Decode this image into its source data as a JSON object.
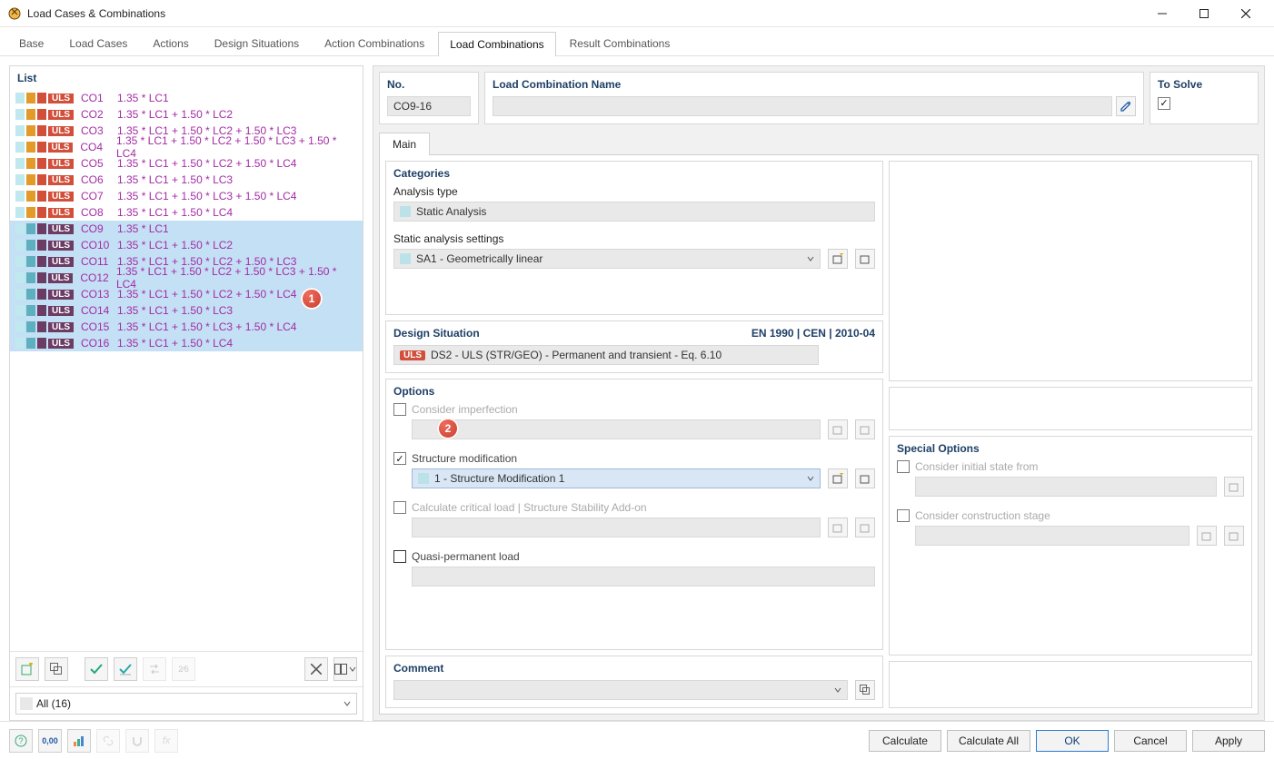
{
  "window": {
    "title": "Load Cases & Combinations"
  },
  "tabs": [
    "Base",
    "Load Cases",
    "Actions",
    "Design Situations",
    "Action Combinations",
    "Load Combinations",
    "Result Combinations"
  ],
  "active_tab_index": 5,
  "list": {
    "heading": "List",
    "items": [
      {
        "sel": false,
        "sw": [
          "lt1",
          "o",
          "r"
        ],
        "ulsClass": "red",
        "uls": "ULS",
        "id": "CO1",
        "desc": "1.35 * LC1"
      },
      {
        "sel": false,
        "sw": [
          "lt1",
          "o",
          "r"
        ],
        "ulsClass": "red",
        "uls": "ULS",
        "id": "CO2",
        "desc": "1.35 * LC1 + 1.50 * LC2"
      },
      {
        "sel": false,
        "sw": [
          "lt1",
          "o",
          "r"
        ],
        "ulsClass": "red",
        "uls": "ULS",
        "id": "CO3",
        "desc": "1.35 * LC1 + 1.50 * LC2 + 1.50 * LC3"
      },
      {
        "sel": false,
        "sw": [
          "lt1",
          "o",
          "r"
        ],
        "ulsClass": "red",
        "uls": "ULS",
        "id": "CO4",
        "desc": "1.35 * LC1 + 1.50 * LC2 + 1.50 * LC3 + 1.50 * LC4"
      },
      {
        "sel": false,
        "sw": [
          "lt1",
          "o",
          "r"
        ],
        "ulsClass": "red",
        "uls": "ULS",
        "id": "CO5",
        "desc": "1.35 * LC1 + 1.50 * LC2 + 1.50 * LC4"
      },
      {
        "sel": false,
        "sw": [
          "lt1",
          "o",
          "r"
        ],
        "ulsClass": "red",
        "uls": "ULS",
        "id": "CO6",
        "desc": "1.35 * LC1 + 1.50 * LC3"
      },
      {
        "sel": false,
        "sw": [
          "lt1",
          "o",
          "r"
        ],
        "ulsClass": "red",
        "uls": "ULS",
        "id": "CO7",
        "desc": "1.35 * LC1 + 1.50 * LC3 + 1.50 * LC4"
      },
      {
        "sel": false,
        "sw": [
          "lt1",
          "o",
          "r"
        ],
        "ulsClass": "red",
        "uls": "ULS",
        "id": "CO8",
        "desc": "1.35 * LC1 + 1.50 * LC4"
      },
      {
        "sel": true,
        "sw": [
          "lt1",
          "db",
          "pu"
        ],
        "ulsClass": "pu",
        "uls": "ULS",
        "id": "CO9",
        "desc": "1.35 * LC1"
      },
      {
        "sel": true,
        "sw": [
          "lt1",
          "db",
          "pu"
        ],
        "ulsClass": "pu",
        "uls": "ULS",
        "id": "CO10",
        "desc": "1.35 * LC1 + 1.50 * LC2"
      },
      {
        "sel": true,
        "sw": [
          "lt1",
          "db",
          "pu"
        ],
        "ulsClass": "pu",
        "uls": "ULS",
        "id": "CO11",
        "desc": "1.35 * LC1 + 1.50 * LC2 + 1.50 * LC3"
      },
      {
        "sel": true,
        "sw": [
          "lt1",
          "db",
          "pu"
        ],
        "ulsClass": "pu",
        "uls": "ULS",
        "id": "CO12",
        "desc": "1.35 * LC1 + 1.50 * LC2 + 1.50 * LC3 + 1.50 * LC4"
      },
      {
        "sel": true,
        "sw": [
          "lt1",
          "db",
          "pu"
        ],
        "ulsClass": "pu",
        "uls": "ULS",
        "id": "CO13",
        "desc": "1.35 * LC1 + 1.50 * LC2 + 1.50 * LC4"
      },
      {
        "sel": true,
        "sw": [
          "lt1",
          "db",
          "pu"
        ],
        "ulsClass": "pu",
        "uls": "ULS",
        "id": "CO14",
        "desc": "1.35 * LC1 + 1.50 * LC3"
      },
      {
        "sel": true,
        "sw": [
          "lt1",
          "db",
          "pu"
        ],
        "ulsClass": "pu",
        "uls": "ULS",
        "id": "CO15",
        "desc": "1.35 * LC1 + 1.50 * LC3 + 1.50 * LC4"
      },
      {
        "sel": true,
        "sw": [
          "lt1",
          "db",
          "pu"
        ],
        "ulsClass": "pu",
        "uls": "ULS",
        "id": "CO16",
        "desc": "1.35 * LC1 + 1.50 * LC4"
      }
    ],
    "filter_label": "All (16)",
    "annot1": "1"
  },
  "header": {
    "no_label": "No.",
    "no_value": "CO9-16",
    "name_label": "Load Combination Name",
    "name_value": "",
    "to_solve_label": "To Solve",
    "to_solve_checked": true
  },
  "inner_tabs": [
    "Main"
  ],
  "categories": {
    "heading": "Categories",
    "analysis_type_label": "Analysis type",
    "analysis_type_value": "Static Analysis",
    "settings_label": "Static analysis settings",
    "settings_value": "SA1 - Geometrically linear"
  },
  "design_situation": {
    "heading": "Design Situation",
    "standard": "EN 1990 | CEN | 2010-04",
    "badge": "ULS",
    "value": "DS2 - ULS (STR/GEO) - Permanent and transient - Eq. 6.10"
  },
  "options": {
    "heading": "Options",
    "annot2": "2",
    "consider_imperfection": {
      "label": "Consider imperfection",
      "checked": false,
      "value": ""
    },
    "structure_modification": {
      "label": "Structure modification",
      "checked": true,
      "value": "1 - Structure Modification 1"
    },
    "critical_load": {
      "label": "Calculate critical load | Structure Stability Add-on",
      "checked": false,
      "value": ""
    },
    "quasi_permanent": {
      "label": "Quasi-permanent load",
      "checked": false,
      "value": ""
    }
  },
  "special_options": {
    "heading": "Special Options",
    "initial_state": {
      "label": "Consider initial state from",
      "checked": false
    },
    "construction_stage": {
      "label": "Consider construction stage",
      "checked": false
    }
  },
  "comment": {
    "heading": "Comment",
    "value": ""
  },
  "footer": {
    "calculate": "Calculate",
    "calculate_all": "Calculate All",
    "ok": "OK",
    "cancel": "Cancel",
    "apply": "Apply"
  }
}
